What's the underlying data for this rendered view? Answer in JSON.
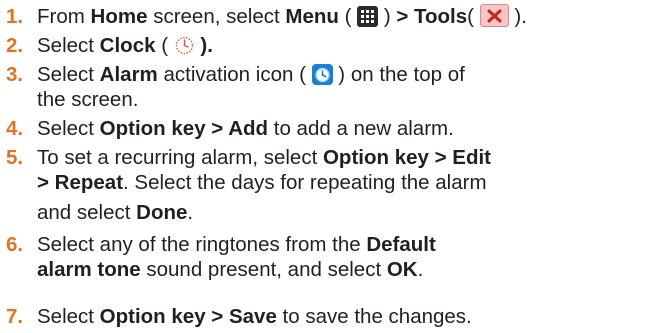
{
  "steps": [
    {
      "number": "1.",
      "lines": [
        {
          "t1": "From ",
          "b1": "Home",
          "t2": " screen, select ",
          "b2": "Menu",
          "t3": " ( ",
          "icon1": "menu-grid-icon",
          "t4": " ) ",
          "b3": "> Tools",
          "t5": "( ",
          "icon2": "tools-icon",
          "t6": " )."
        }
      ]
    },
    {
      "number": "2.",
      "lines": [
        {
          "t1": "Select ",
          "b1": "Clock",
          "t2": " ( ",
          "icon1": "clock-icon",
          "t3": " ",
          "b2": ")."
        }
      ]
    },
    {
      "number": "3.",
      "lines": [
        {
          "t1": "Select ",
          "b1": "Alarm",
          "t2": " activation icon ( ",
          "icon1": "alarm-icon",
          "t3": " ) on the top of"
        },
        {
          "t1": "the screen."
        }
      ]
    },
    {
      "number": "4.",
      "lines": [
        {
          "t1": "Select ",
          "b1": "Option key > Add",
          "t2": " to add a new alarm."
        }
      ]
    },
    {
      "number": "5.",
      "lines": [
        {
          "t1": "To set a recurring alarm, select ",
          "b1": "Option key > Edit"
        },
        {
          "b1": "> Repeat",
          "t1": ". Select the days for repeating the alarm"
        },
        {
          "t1": "and select ",
          "b1": "Done",
          "t2": "."
        }
      ]
    },
    {
      "number": "6.",
      "lines": [
        {
          "t1": "Select any of the ringtones from the ",
          "b1": "Default"
        },
        {
          "b1": "alarm tone",
          "t1": " sound present, and select ",
          "b2": "OK",
          "t2": "."
        }
      ]
    },
    {
      "number": "7.",
      "lines": [
        {
          "t1": "Select ",
          "b1": "Option key > Save",
          "t2": " to save the changes."
        }
      ]
    }
  ],
  "colors": {
    "number": "#e37222",
    "text": "#231f20",
    "menu_icon_bg": "#2b2b2b",
    "tools_icon_bg": "#f5c6c6",
    "alarm_icon_bg": "#1d7fd1"
  }
}
